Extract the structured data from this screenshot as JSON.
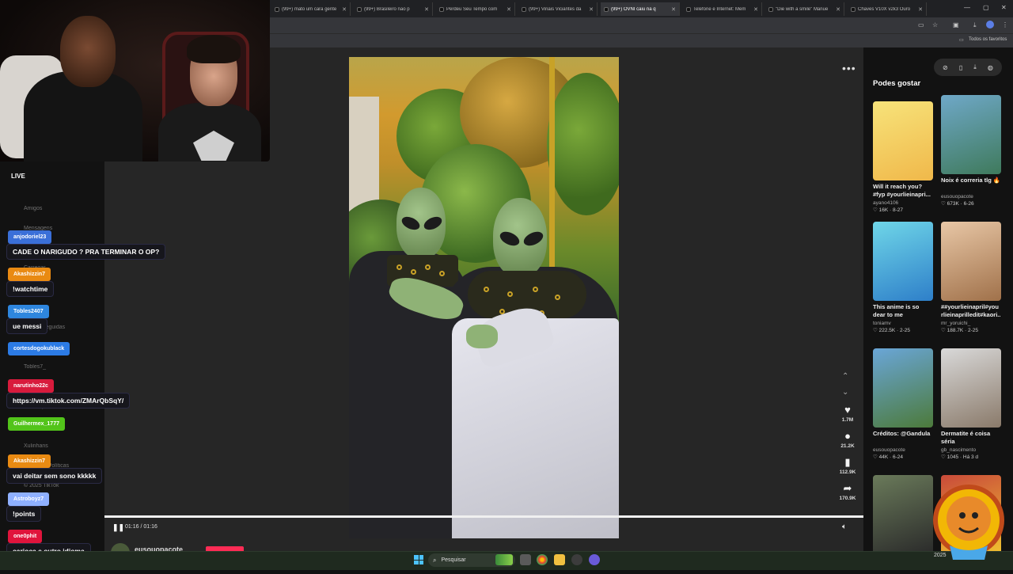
{
  "browser": {
    "tabs": [
      {
        "label": "(99+) mato um cara gente"
      },
      {
        "label": "(99+) Brasileiro não p"
      },
      {
        "label": "Perdeu Seu Tempo com"
      },
      {
        "label": "(99+) Vinais Viciantes da"
      },
      {
        "label": "(99+) OVNI caiu na q",
        "active": true
      },
      {
        "label": "Telefone e Internet: Mem"
      },
      {
        "label": "\"Die with a smile\" Manue"
      },
      {
        "label": "Chaves V10X v2k3 Ouro"
      }
    ],
    "bookmarks_label": "Todos os favoritos"
  },
  "stream": {
    "live_label": "LIVE"
  },
  "sidebar_ghost": [
    "Amigos",
    "Mensagens",
    "Notificações",
    "Carregar",
    "Perfil",
    "Mais",
    "Contas seguidas",
    "Goku black",
    "Tobles7_",
    "op",
    "Terra Updates Of",
    "joyydesign",
    "Xulinhans",
    "Termos e Políticas",
    "© 2025 TikTok"
  ],
  "chat": [
    {
      "user": "anjodoriel23",
      "user_color": "#3a6fd8",
      "message": "CADE O NARIGUDO ? PRA TERMINAR O OP?"
    },
    {
      "user": "Akashizzin7",
      "user_color": "#e98a12",
      "message": "!watchtime"
    },
    {
      "user": "Tobles2407",
      "user_color": "#2e86de",
      "message": "ue messi"
    },
    {
      "user": "cortesdogokublack",
      "user_color": "#2c7be5",
      "message": ""
    },
    {
      "user": "narutinho22c",
      "user_color": "#d81b3c",
      "message": "https://vm.tiktok.com/ZMArQbSqY/"
    },
    {
      "user": "Guilhermex_1777",
      "user_color": "#52c41a",
      "message": ""
    },
    {
      "user": "Akashizzin7",
      "user_color": "#e98a12",
      "message": "vai deitar sem sono kkkkk"
    },
    {
      "user": "Astroboyz7",
      "user_color": "#8fb0ff",
      "message": "!points"
    },
    {
      "user": "one0phit",
      "user_color": "#e0143c",
      "message": "carioca e outro idioma"
    }
  ],
  "video": {
    "elapsed": "01:16",
    "duration": "01:16",
    "time_label": "01:16 / 01:16",
    "progress": 1.0,
    "author": "eusouopacote",
    "actions": {
      "likes": "1.7M",
      "comments": "21.2K",
      "saves": "112.9K",
      "shares": "170.9K"
    }
  },
  "right_panel": {
    "heading": "Podes gostar",
    "cards": [
      {
        "title": "Will it reach you? #fyp #yourlieinapri...",
        "author": "ayano4106",
        "meta": "♡ 16K · 8-27",
        "thumb": [
          "#f7e37a",
          "#f0b84a"
        ]
      },
      {
        "title": "Noix é correria tlg 🔥",
        "author": "eusouopacote",
        "meta": "♡ 673K · 6-26",
        "thumb": [
          "#6fa8c8",
          "#3f7a5c"
        ]
      },
      {
        "title": "This anime is so dear to me #yourlieinapr...",
        "author": "toniamv",
        "meta": "♡ 222.5K · 2-25",
        "thumb": [
          "#6fd6e8",
          "#2e7fc9"
        ]
      },
      {
        "title": "##yourlieinapril#you rlieinaprilledit#kaori...",
        "author": "mr_yoruichi_",
        "meta": "♡ 188.7K · 2-25",
        "thumb": [
          "#e8c7a6",
          "#a0714a"
        ]
      },
      {
        "title": "Créditos: @Gandula",
        "author": "eusouopacote",
        "meta": "♡ 44K · 6-24",
        "thumb": [
          "#6aa6d8",
          "#4c7a3a"
        ]
      },
      {
        "title": "Dermatite é coisa séria",
        "author": "gb_nascimento",
        "meta": "♡ 1045 · Há 3 d",
        "thumb": [
          "#d9d9d9",
          "#8a7a6a"
        ]
      },
      {
        "title": "",
        "author": "",
        "meta": "",
        "thumb": [
          "#6a7a5a",
          "#2a2a2a"
        ]
      },
      {
        "title": "",
        "author": "",
        "meta": "",
        "thumb": [
          "#c94a3a",
          "#f0c030"
        ]
      }
    ]
  },
  "taskbar": {
    "search_placeholder": "Pesquisar",
    "year": "2025"
  },
  "colors": {
    "accent": "#fe2c55",
    "tiktok_bg": "#121212",
    "video_bg": "#262626"
  }
}
